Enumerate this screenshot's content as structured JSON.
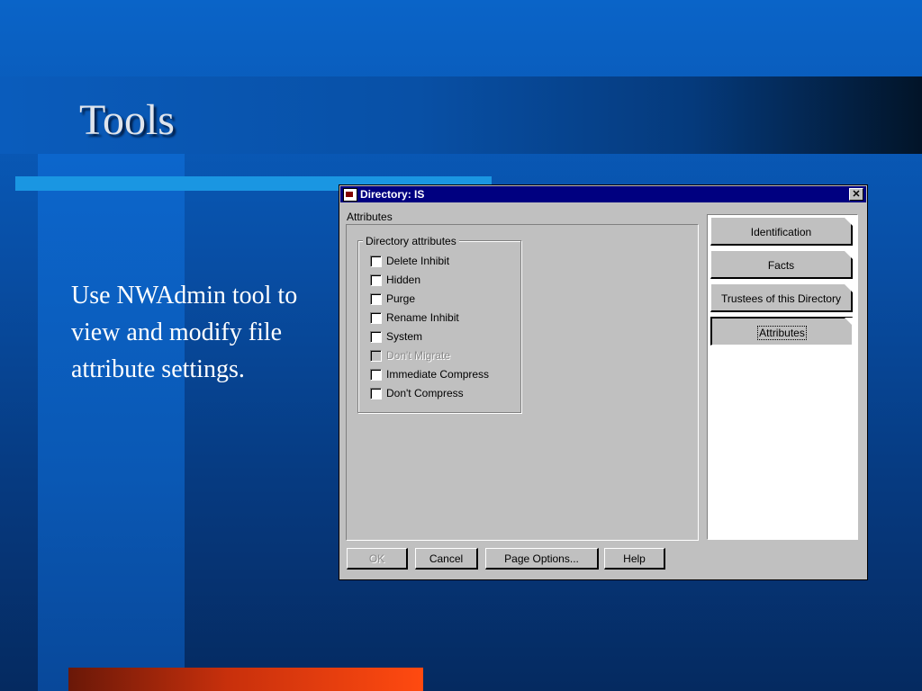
{
  "slide": {
    "title": "Tools",
    "body": "Use NWAdmin tool to view and modify file attribute settings."
  },
  "dialog": {
    "title": "Directory: IS",
    "close_glyph": "✕",
    "page_label": "Attributes",
    "group_label": "Directory attributes",
    "checkboxes": [
      {
        "label": "Delete Inhibit",
        "checked": false,
        "disabled": false
      },
      {
        "label": "Hidden",
        "checked": false,
        "disabled": false
      },
      {
        "label": "Purge",
        "checked": false,
        "disabled": false
      },
      {
        "label": "Rename Inhibit",
        "checked": false,
        "disabled": false
      },
      {
        "label": "System",
        "checked": false,
        "disabled": false
      },
      {
        "label": "Don't Migrate",
        "checked": false,
        "disabled": true
      },
      {
        "label": "Immediate Compress",
        "checked": false,
        "disabled": false
      },
      {
        "label": "Don't Compress",
        "checked": false,
        "disabled": false
      }
    ],
    "tabs": [
      {
        "label": "Identification",
        "active": false
      },
      {
        "label": "Facts",
        "active": false
      },
      {
        "label": "Trustees of this Directory",
        "active": false
      },
      {
        "label": "Attributes",
        "active": true
      }
    ],
    "buttons": {
      "ok": "OK",
      "cancel": "Cancel",
      "page_options": "Page Options...",
      "help": "Help"
    }
  },
  "colors": {
    "slide_background": "#0a5cbc",
    "title_rule": "#1a96e2",
    "accent_bar": "#ff4a10",
    "dialog_face": "#c0c0c0",
    "titlebar": "#000080"
  }
}
